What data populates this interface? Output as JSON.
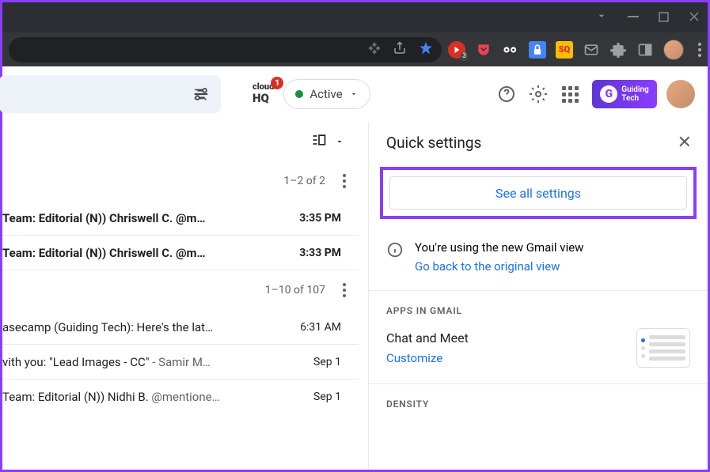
{
  "browser": {
    "extensions": {
      "badge_count": "3"
    }
  },
  "header": {
    "cloudhq_text": "cloud",
    "cloudhq_hq": "HQ",
    "cloudhq_badge": "1",
    "active_label": "Active",
    "gt_label1": "Guiding",
    "gt_label2": "Tech"
  },
  "pagination": {
    "section1": "1–2 of 2",
    "section2": "1–10 of 107"
  },
  "emails": {
    "s1": [
      {
        "subject": "Team: Editorial (N)) Chriswell C. @m…",
        "time": "3:35 PM"
      },
      {
        "subject": "Team: Editorial (N)) Chriswell C. @m…",
        "time": "3:33 PM"
      }
    ],
    "s2": [
      {
        "subject": "asecamp (Guiding Tech): Here's the lat…",
        "time": "6:31 AM"
      },
      {
        "subject_pre": "vith you: \"Lead Images - CC\" ",
        "subject_grey": "- Samir M…",
        "time": "Sep 1"
      },
      {
        "subject_pre": "Team: Editorial (N)) Nidhi B. ",
        "subject_grey": "@mentione…",
        "time": "Sep 1"
      }
    ]
  },
  "settings": {
    "title": "Quick settings",
    "see_all": "See all settings",
    "info_line": "You're using the new Gmail view",
    "info_link": "Go back to the original view",
    "apps_header": "APPS IN GMAIL",
    "chat_meet": "Chat and Meet",
    "customize": "Customize",
    "density_header": "DENSITY"
  }
}
